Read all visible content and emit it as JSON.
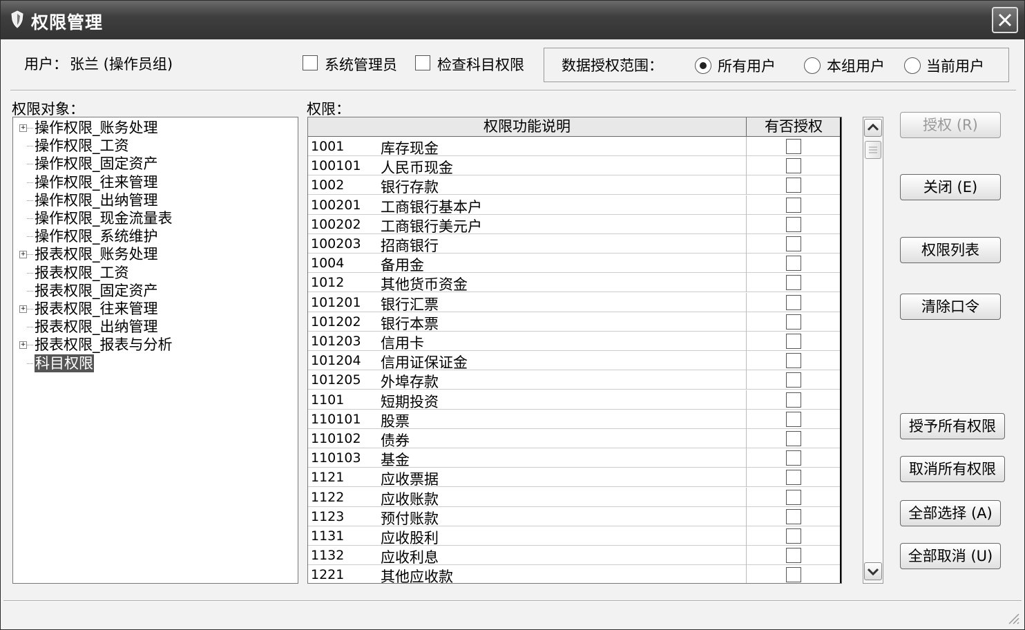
{
  "window": {
    "title": "权限管理",
    "icon": "shield-icon"
  },
  "header": {
    "user_label": "用户：",
    "user_value": "张兰 (操作员组)",
    "admin_checkbox": {
      "label": "系统管理员",
      "checked": false
    },
    "check_subject_checkbox": {
      "label": "检查科目权限",
      "checked": false
    },
    "scope": {
      "label": "数据授权范围：",
      "options": [
        {
          "label": "所有用户",
          "selected": true
        },
        {
          "label": "本组用户",
          "selected": false
        },
        {
          "label": "当前用户",
          "selected": false
        }
      ]
    }
  },
  "left": {
    "label": "权限对象：",
    "items": [
      {
        "label": "操作权限_账务处理",
        "expandable": true,
        "selected": false
      },
      {
        "label": "操作权限_工资",
        "expandable": false,
        "selected": false
      },
      {
        "label": "操作权限_固定资产",
        "expandable": false,
        "selected": false
      },
      {
        "label": "操作权限_往来管理",
        "expandable": false,
        "selected": false
      },
      {
        "label": "操作权限_出纳管理",
        "expandable": false,
        "selected": false
      },
      {
        "label": "操作权限_现金流量表",
        "expandable": false,
        "selected": false
      },
      {
        "label": "操作权限_系统维护",
        "expandable": false,
        "selected": false
      },
      {
        "label": "报表权限_账务处理",
        "expandable": true,
        "selected": false
      },
      {
        "label": "报表权限_工资",
        "expandable": false,
        "selected": false
      },
      {
        "label": "报表权限_固定资产",
        "expandable": false,
        "selected": false
      },
      {
        "label": "报表权限_往来管理",
        "expandable": true,
        "selected": false
      },
      {
        "label": "报表权限_出纳管理",
        "expandable": false,
        "selected": false
      },
      {
        "label": "报表权限_报表与分析",
        "expandable": true,
        "selected": false
      },
      {
        "label": "科目权限",
        "expandable": false,
        "selected": true
      }
    ]
  },
  "grid": {
    "label": "权限：",
    "columns": [
      "权限功能说明",
      "有否授权"
    ],
    "rows": [
      {
        "code": "1001",
        "name": "库存现金"
      },
      {
        "code": "100101",
        "name": "人民币现金"
      },
      {
        "code": "1002",
        "name": "银行存款"
      },
      {
        "code": "100201",
        "name": "工商银行基本户"
      },
      {
        "code": "100202",
        "name": "工商银行美元户"
      },
      {
        "code": "100203",
        "name": "招商银行"
      },
      {
        "code": "1004",
        "name": "备用金"
      },
      {
        "code": "1012",
        "name": "其他货币资金"
      },
      {
        "code": "101201",
        "name": "银行汇票"
      },
      {
        "code": "101202",
        "name": "银行本票"
      },
      {
        "code": "101203",
        "name": "信用卡"
      },
      {
        "code": "101204",
        "name": "信用证保证金"
      },
      {
        "code": "101205",
        "name": "外埠存款"
      },
      {
        "code": "1101",
        "name": "短期投资"
      },
      {
        "code": "110101",
        "name": "股票"
      },
      {
        "code": "110102",
        "name": "债券"
      },
      {
        "code": "110103",
        "name": "基金"
      },
      {
        "code": "1121",
        "name": "应收票据"
      },
      {
        "code": "1122",
        "name": "应收账款"
      },
      {
        "code": "1123",
        "name": "预付账款"
      },
      {
        "code": "1131",
        "name": "应收股利"
      },
      {
        "code": "1132",
        "name": "应收利息"
      },
      {
        "code": "1221",
        "name": "其他应收款"
      }
    ]
  },
  "buttons": {
    "grant": "授权 (R)",
    "close": "关闭 (E)",
    "perm_list": "权限列表",
    "clear_password": "清除口令",
    "grant_all": "授予所有权限",
    "revoke_all": "取消所有权限",
    "select_all": "全部选择 (A)",
    "deselect_all": "全部取消 (U)"
  }
}
